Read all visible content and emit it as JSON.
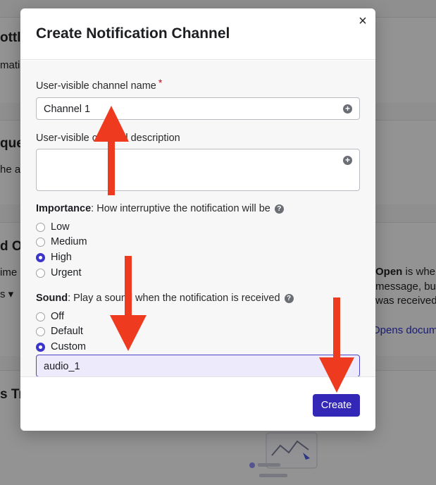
{
  "background": {
    "card1_heading": "ottli",
    "card1_text": "matic",
    "card2_heading": "que",
    "card2_text": "he ar",
    "card3_heading": "d O",
    "card3_text": "ime p",
    "card3_select": "s ▾",
    "card3_right_line1_bold": "Open",
    "card3_right_line1_rest": " is whe",
    "card3_right_line2": "message, but",
    "card3_right_line3": "was received.",
    "card3_link": "Opens docum",
    "card4_heading": "s Tr"
  },
  "modal": {
    "title": "Create Notification Channel",
    "close_glyph": "×",
    "name_label": "User-visible channel name",
    "required_mark": "*",
    "name_value": "Channel 1",
    "description_label": "User-visible channel description",
    "description_value": "",
    "importance": {
      "label_bold": "Importance",
      "label_rest": ": How interruptive the notification will be",
      "options": [
        "Low",
        "Medium",
        "High",
        "Urgent"
      ],
      "selected": "High"
    },
    "sound": {
      "label_bold": "Sound",
      "label_rest": ": Play a sound when the notification is received",
      "options": [
        "Off",
        "Default",
        "Custom"
      ],
      "selected": "Custom",
      "custom_value": "audio_1"
    },
    "create_label": "Create"
  },
  "icons": {
    "plus": "plus-circle-icon",
    "help": "question-circle-icon",
    "close": "close-icon"
  },
  "colors": {
    "accent": "#3227b6",
    "arrow": "#ee3b1f",
    "required": "#d0021b"
  }
}
